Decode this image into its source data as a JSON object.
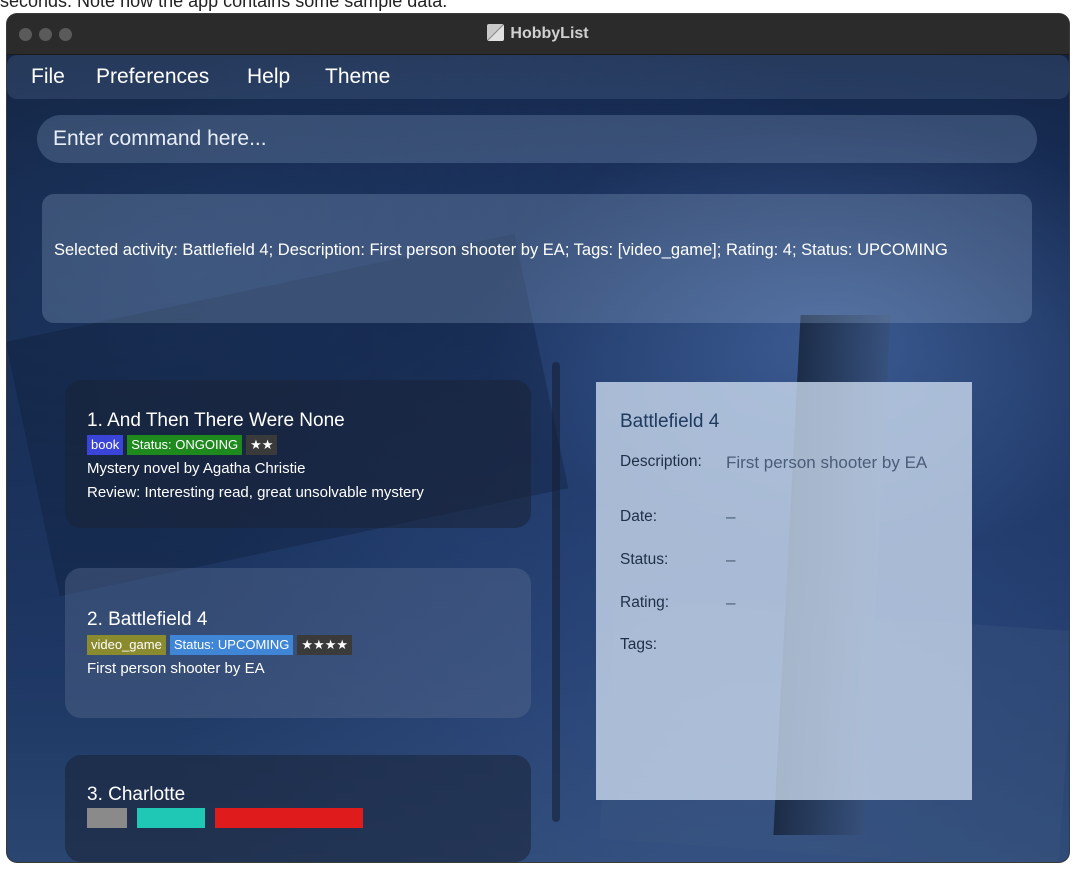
{
  "caption": "seconds. Note how the app contains some sample data.",
  "window": {
    "title": "HobbyList"
  },
  "menu": [
    "File",
    "Preferences",
    "Help",
    "Theme"
  ],
  "command": {
    "placeholder": "Enter command here...",
    "value": ""
  },
  "result": {
    "text": "Selected activity: Battlefield 4; Description: First person shooter by EA; Tags: [video_game]; Rating: 4; Status: UPCOMING"
  },
  "activities": [
    {
      "title": "1.  And Then There Were None",
      "chips": [
        {
          "text": "book",
          "color": "#3b44d9"
        },
        {
          "text": "Status: ONGOING",
          "color": "#1e8a1e"
        },
        {
          "text": "★★",
          "color": "#3a3a3a"
        }
      ],
      "lines": [
        "Mystery novel by Agatha Christie",
        "Review: Interesting read, great unsolvable mystery"
      ]
    },
    {
      "title": "2.  Battlefield 4",
      "chips": [
        {
          "text": "video_game",
          "color": "#8a8a2e"
        },
        {
          "text": "Status: UPCOMING",
          "color": "#3f86d6"
        },
        {
          "text": "★★★★",
          "color": "#3a3a3a"
        }
      ],
      "lines": [
        "First person shooter by EA"
      ]
    },
    {
      "title": "3.  Charlotte",
      "chips": [
        {
          "text": "",
          "color": "#8a8a8a"
        },
        {
          "text": "",
          "color": "#1ec8b4"
        },
        {
          "text": "",
          "color": "#e01b1b"
        }
      ],
      "lines": []
    }
  ],
  "detail": {
    "title": "Battlefield 4",
    "description_label": "Description:",
    "description": "First person shooter by EA",
    "date_label": "Date:",
    "date": "–",
    "status_label": "Status:",
    "status": "–",
    "rating_label": "Rating:",
    "rating": "–",
    "tags_label": "Tags:"
  }
}
